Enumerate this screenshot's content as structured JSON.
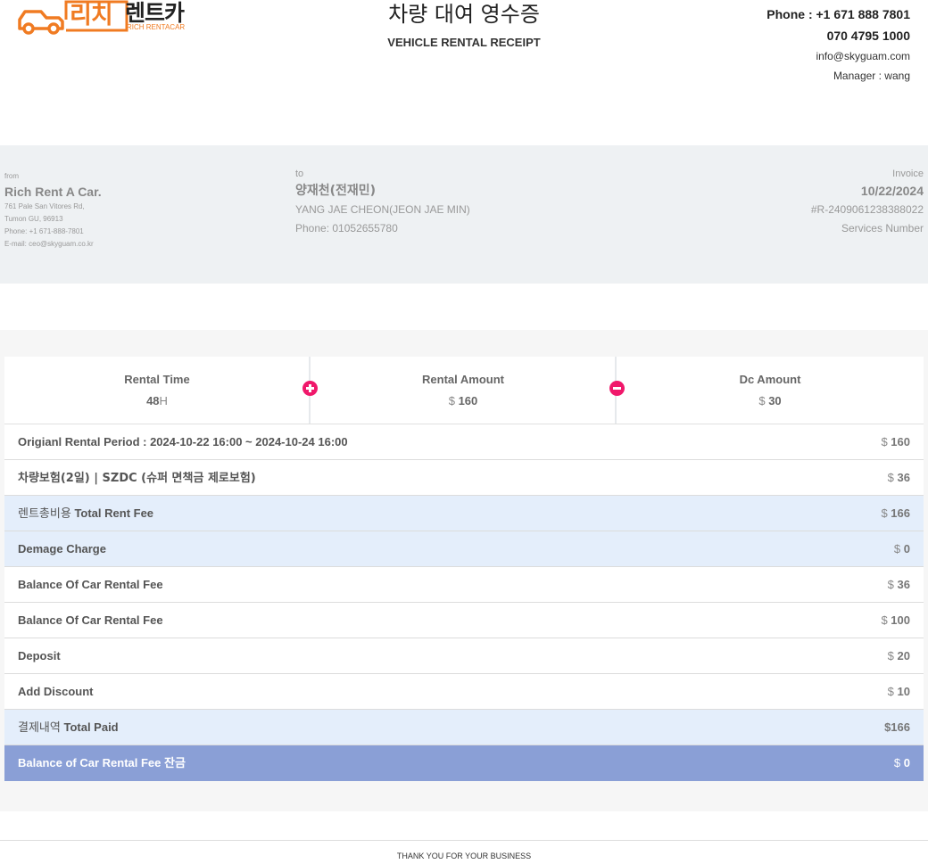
{
  "logo": {
    "ko_text": "리치렌트카",
    "en_text": "RICH RENTACAR",
    "brand_color": "#f07b22",
    "icon": "car-icon"
  },
  "header": {
    "title_ko": "차량 대여 영수증",
    "title_en": "VEHICLE RENTAL RECEIPT",
    "phone1": "Phone : +1 671 888 7801",
    "phone2": "070 4795 1000",
    "email": "info@skyguam.com",
    "manager": "Manager : wang"
  },
  "from": {
    "label": "from",
    "name": "Rich Rent A Car.",
    "address1": "761 Pale San Vitores Rd,",
    "address2": "Tumon GU, 96913",
    "phone": "Phone: +1 671-888-7801",
    "email": "E-mail: ceo@skyguam.co.kr"
  },
  "to": {
    "label": "to",
    "name_ko": "양재천(전재민)",
    "name_en": "YANG JAE CHEON(JEON JAE MIN)",
    "phone": "Phone: 01052655780"
  },
  "invoice": {
    "label": "Invoice",
    "date": "10/22/2024",
    "number": "#R-2409061238388022",
    "services": "Services Number"
  },
  "stats": {
    "rental_time": {
      "title": "Rental Time",
      "value": "48",
      "unit": "H"
    },
    "rental_amount": {
      "title": "Rental Amount",
      "currency": "$",
      "value": "160"
    },
    "dc_amount": {
      "title": "Dc Amount",
      "currency": "$",
      "value": "30"
    },
    "plus_color": "#f0186b"
  },
  "rows": [
    {
      "label": "Origianl Rental Period : 2024-10-22 16:00 ~ 2024-10-24 16:00",
      "currency": "$",
      "amount": "160"
    },
    {
      "label_ko": "차량보험(2일) | SZDC (슈퍼 면책금 제로보험)",
      "currency": "$",
      "amount": "36"
    },
    {
      "label_ko": "렌트총비용",
      "label_en": "Total Rent Fee",
      "currency": "$",
      "amount": "166"
    },
    {
      "label": "Demage Charge",
      "currency": "$",
      "amount": "0"
    },
    {
      "label": "Balance Of Car Rental Fee",
      "currency": "$",
      "amount": "36"
    },
    {
      "label": "Balance Of Car Rental Fee",
      "currency": "$",
      "amount": "100"
    },
    {
      "label": "Deposit",
      "currency": "$",
      "amount": "20"
    },
    {
      "label": "Add Discount",
      "currency": "$",
      "amount": "10"
    },
    {
      "label_ko": "결제내역",
      "label_en": "Total Paid",
      "amount_text": "$166"
    },
    {
      "label_en": "Balance of Car Rental Fee",
      "label_ko": "잔금",
      "currency": "$",
      "amount": "0"
    }
  ],
  "footer": {
    "text": "THANK YOU FOR YOUR BUSINESS"
  }
}
